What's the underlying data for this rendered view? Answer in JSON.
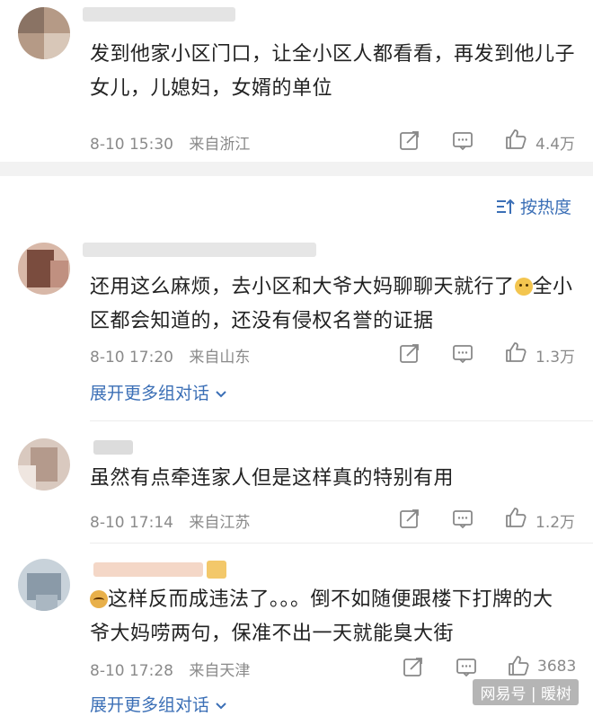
{
  "sort": {
    "label": "按热度"
  },
  "comments": [
    {
      "text": "发到他家小区门口，让全小区人都看看，再发到他儿子女儿，儿媳妇，女婿的单位",
      "time": "8-10 15:30",
      "location": "来自浙江",
      "likes": "4.4万"
    },
    {
      "text_a": "还用这么麻烦，去小区和大爷大妈聊聊天就行了",
      "text_b": "全小区都会知道的，还没有侵权名誉的证据",
      "time": "8-10 17:20",
      "location": "来自山东",
      "likes": "1.3万",
      "expand": "展开更多组对话"
    },
    {
      "text": "虽然有点牵连家人但是这样真的特别有用",
      "time": "8-10 17:14",
      "location": "来自江苏",
      "likes": "1.2万"
    },
    {
      "text": "这样反而成违法了。。。倒不如随便跟楼下打牌的大爷大妈唠两句，保准不出一天就能臭大街",
      "time": "8-10 17:28",
      "location": "来自天津",
      "likes": "3683",
      "expand": "展开更多组对话"
    }
  ],
  "watermark": "网易号 | 暖树",
  "colors": {
    "link": "#3b6fb6",
    "meta": "#8a8a8a",
    "separator": "#f0f0f0"
  },
  "icons": [
    "share-icon",
    "comment-icon",
    "like-icon",
    "emoji-dog-icon",
    "emoji-cat-icon",
    "sort-icon",
    "chevron-down-icon"
  ]
}
